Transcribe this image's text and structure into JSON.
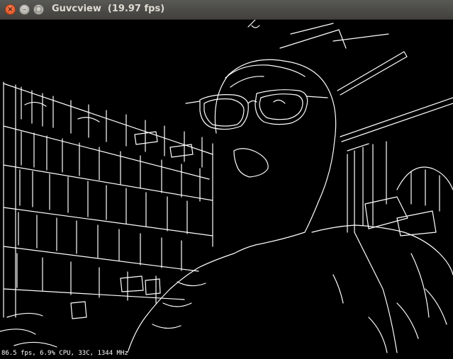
{
  "window": {
    "title": "Guvcview  (19.97 fps)",
    "buttons": {
      "close_icon": "close-icon",
      "minimize_icon": "minimize-icon",
      "maximize_icon": "maximize-icon"
    }
  },
  "overlay": {
    "status_text": "86.5 fps, 6.9% CPU, 33C, 1344 MHz"
  },
  "colors": {
    "titlebar": "#4a4945",
    "close": "#e95420",
    "edge_lines": "#ffffff",
    "background": "#000000"
  }
}
